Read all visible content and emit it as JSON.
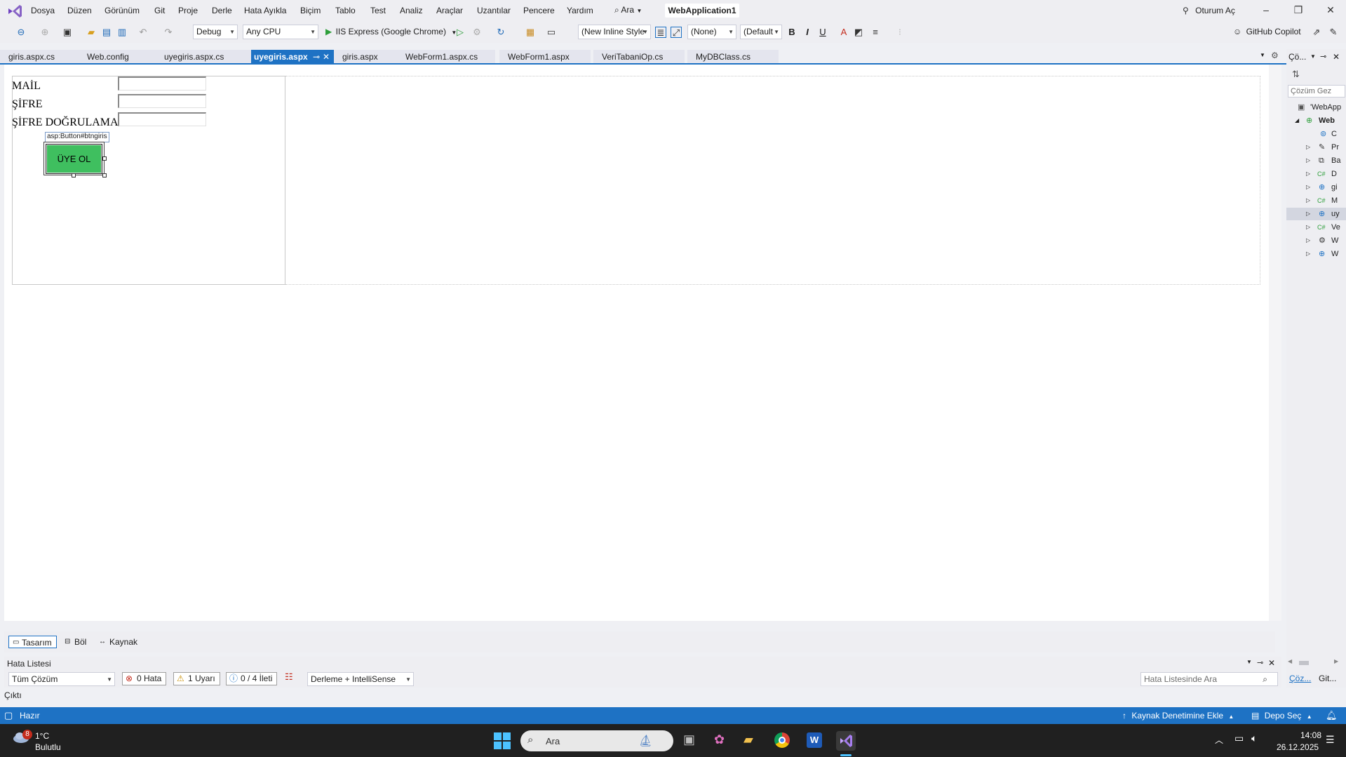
{
  "menu": {
    "items": [
      "Dosya",
      "Düzen",
      "Görünüm",
      "Git",
      "Proje",
      "Derle",
      "Hata Ayıkla",
      "Biçim",
      "Tablo",
      "Test",
      "Analiz",
      "Araçlar",
      "Uzantılar",
      "Pencere",
      "Yardım"
    ],
    "search_label": "Ara",
    "solution_title": "WebApplication1",
    "signin": "Oturum Aç"
  },
  "toolbar": {
    "config": "Debug",
    "platform": "Any CPU",
    "run_target": "IIS Express (Google Chrome)",
    "style_dropdown": "(New Inline Style",
    "target_rule": "(None)",
    "font_dropdown": "(Default",
    "bold": "B",
    "italic": "I",
    "underline": "U",
    "copilot": "GitHub Copilot"
  },
  "tabs": [
    {
      "label": "giris.aspx.cs",
      "active": false
    },
    {
      "label": "Web.config",
      "active": false
    },
    {
      "label": "uyegiris.aspx.cs",
      "active": false
    },
    {
      "label": "uyegiris.aspx",
      "active": true
    },
    {
      "label": "giris.aspx",
      "active": false
    },
    {
      "label": "WebForm1.aspx.cs",
      "active": false
    },
    {
      "label": "WebForm1.aspx",
      "active": false
    },
    {
      "label": "VeriTabaniOp.cs",
      "active": false
    },
    {
      "label": "MyDBClass.cs",
      "active": false
    }
  ],
  "design": {
    "labels": [
      "MAİL",
      "ŞİFRE",
      "ŞİFRE DOĞRULAMA"
    ],
    "button_tag": "asp:Button#btngiris",
    "button_text": "ÜYE OL"
  },
  "view_tabs": [
    "Tasarım",
    "Böl",
    "Kaynak"
  ],
  "error_list": {
    "title": "Hata Listesi",
    "scope": "Tüm Çözüm",
    "errors": "0 Hata",
    "warnings": "1 Uyarı",
    "messages": "0 / 4 İleti",
    "build_filter": "Derleme + IntelliSense",
    "search_placeholder": "Hata Listesinde Ara"
  },
  "output_label": "Çıktı",
  "status": {
    "ready": "Hazır",
    "add_source_control": "Kaynak Denetimine Ekle",
    "select_repo": "Depo Seç"
  },
  "solution_explorer": {
    "title": "Çö...",
    "search": "Çözüm Gez",
    "rows": [
      {
        "label": "'WebApp",
        "icon": "solution-icon"
      },
      {
        "label": "Web",
        "icon": "project-icon"
      },
      {
        "label": "C",
        "icon": "connected-services-icon"
      },
      {
        "label": "Pr",
        "icon": "properties-icon"
      },
      {
        "label": "Ba",
        "icon": "references-icon"
      },
      {
        "label": "D",
        "icon": "csharp-file-icon"
      },
      {
        "label": "gi",
        "icon": "web-form-icon"
      },
      {
        "label": "M",
        "icon": "csharp-file-icon"
      },
      {
        "label": "uy",
        "icon": "web-form-icon"
      },
      {
        "label": "Ve",
        "icon": "csharp-file-icon"
      },
      {
        "label": "W",
        "icon": "config-file-icon"
      },
      {
        "label": "W",
        "icon": "web-form-icon"
      }
    ],
    "bottom_tabs": [
      "Çöz...",
      "Git..."
    ]
  },
  "taskbar": {
    "weather_temp": "1°C",
    "weather_desc": "Bulutlu",
    "weather_badge": "8",
    "search_label": "Ara",
    "time": "14:08",
    "date": "26.12.2025"
  },
  "colors": {
    "accent": "#1e72c4",
    "button_green": "#3fbf5f",
    "statusbar": "#1e72c4",
    "taskbar": "#202020"
  }
}
